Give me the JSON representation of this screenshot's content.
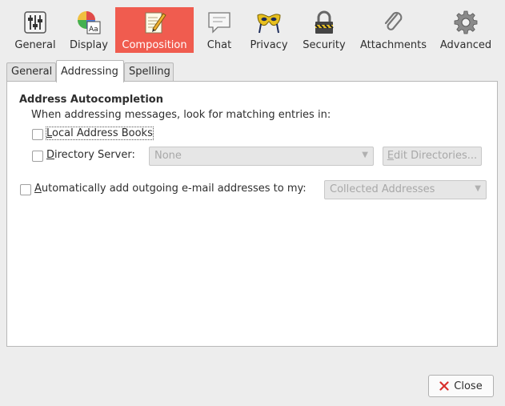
{
  "panes": [
    {
      "label": "General",
      "icon": "sliders-icon",
      "selected": false
    },
    {
      "label": "Display",
      "icon": "color-wheel-font-icon",
      "selected": false
    },
    {
      "label": "Composition",
      "icon": "pencil-document-icon",
      "selected": true
    },
    {
      "label": "Chat",
      "icon": "speech-bubble-icon",
      "selected": false
    },
    {
      "label": "Privacy",
      "icon": "mask-icon",
      "selected": false
    },
    {
      "label": "Security",
      "icon": "padlock-icon",
      "selected": false
    },
    {
      "label": "Attachments",
      "icon": "paperclip-icon",
      "selected": false
    },
    {
      "label": "Advanced",
      "icon": "gear-icon",
      "selected": false
    }
  ],
  "tabs": [
    {
      "label": "General",
      "active": false
    },
    {
      "label": "Addressing",
      "active": true
    },
    {
      "label": "Spelling",
      "active": false
    }
  ],
  "addressing": {
    "heading": "Address Autocompletion",
    "description": "When addressing messages, look for matching entries in:",
    "local_address_books": {
      "label": "Local Address Books",
      "checked": false
    },
    "directory_server": {
      "label": "Directory Server:",
      "checked": false,
      "value": "None"
    },
    "edit_directories_label": "Edit Directories...",
    "auto_add": {
      "label": "Automatically add outgoing e-mail addresses to my:",
      "checked": false,
      "value": "Collected Addresses"
    }
  },
  "footer": {
    "close_label": "Close"
  },
  "colors": {
    "selected_pane": "#f05c4f",
    "close_icon": "#d9302c"
  }
}
